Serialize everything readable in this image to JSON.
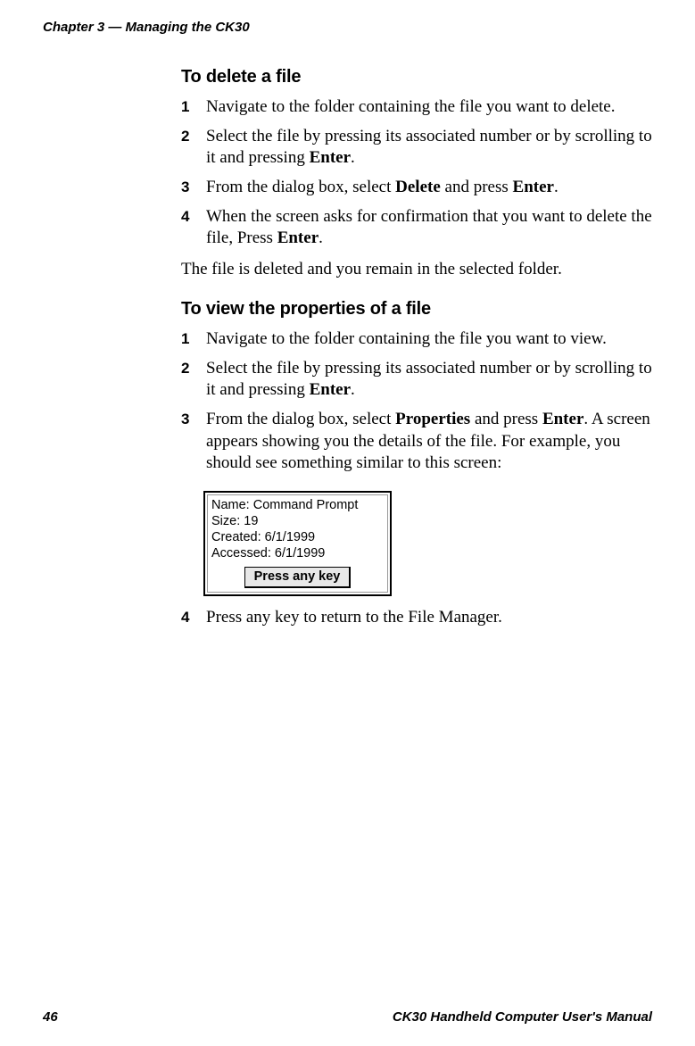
{
  "header": "Chapter 3 — Managing the CK30",
  "section1": {
    "heading": "To delete a file",
    "steps": [
      {
        "n": "1",
        "pre": "Navigate to the folder containing the file you want to delete.",
        "bold": "",
        "post": ""
      },
      {
        "n": "2",
        "pre": "Select the file by pressing its associated number or by scrolling to it and pressing ",
        "bold": "Enter",
        "post": "."
      },
      {
        "n": "3",
        "pre": "From the dialog box, select ",
        "bold": "Delete",
        "mid": " and press ",
        "bold2": "Enter",
        "post": "."
      },
      {
        "n": "4",
        "pre": "When the screen asks for confirmation that you want to delete the file, Press ",
        "bold": "Enter",
        "post": "."
      }
    ],
    "para": "The file is deleted and you remain in the selected folder."
  },
  "section2": {
    "heading": "To view the properties of a file",
    "steps": [
      {
        "n": "1",
        "pre": "Navigate to the folder containing the file you want to view.",
        "bold": "",
        "post": ""
      },
      {
        "n": "2",
        "pre": "Select the file by pressing its associated number or by scrolling to it and pressing ",
        "bold": "Enter",
        "post": "."
      },
      {
        "n": "3",
        "pre": "From the dialog box, select ",
        "bold": "Properties",
        "mid": " and press ",
        "bold2": "Enter",
        "post": ". A screen appears showing you the details of the file. For example, you should see something similar to this screen:"
      }
    ],
    "screenshot": {
      "line1": "Name: Command Prompt",
      "line2": "Size: 19",
      "line3": "Created: 6/1/1999",
      "line4": "Accessed: 6/1/1999",
      "button": "Press any key"
    },
    "step4": {
      "n": "4",
      "text": "Press any key to return to the File Manager."
    }
  },
  "footer": {
    "pageNumber": "46",
    "title": "CK30 Handheld Computer User's Manual"
  }
}
